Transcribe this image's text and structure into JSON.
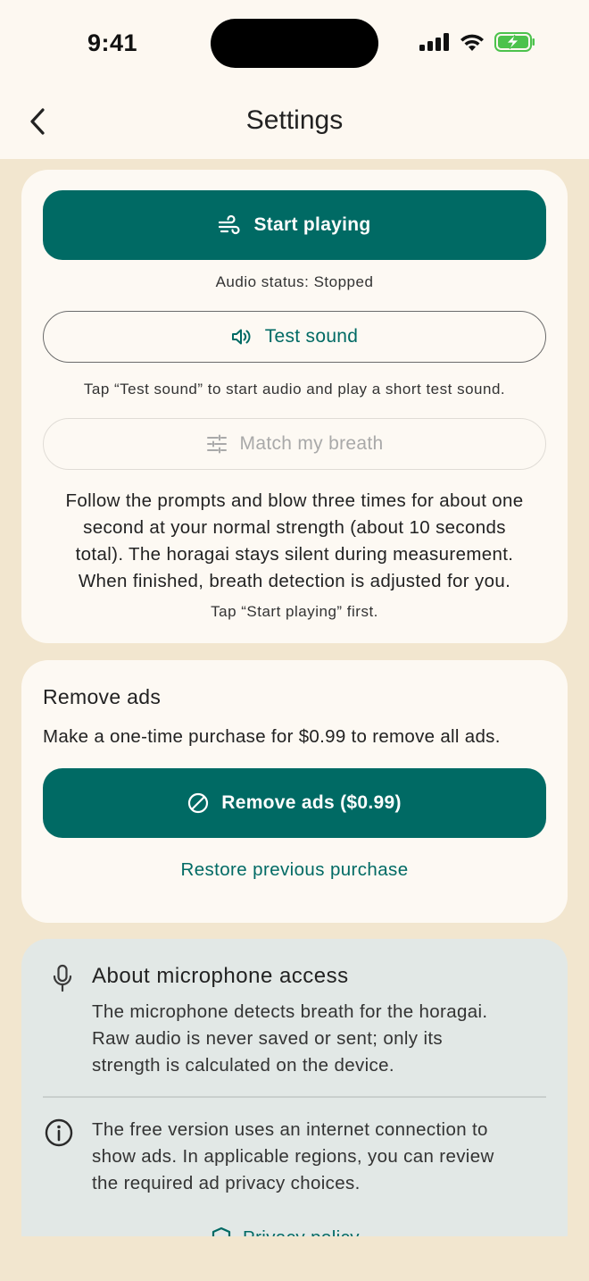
{
  "status": {
    "time": "9:41"
  },
  "nav": {
    "title": "Settings"
  },
  "audio_card": {
    "start_button": "Start playing",
    "audio_status": "Audio status: Stopped",
    "test_button": "Test sound",
    "test_hint": "Tap “Test sound” to start audio and play a short test sound.",
    "match_button": "Match my breath",
    "match_description_lines": [
      "Follow the prompts and blow three times for about one",
      "second at your normal strength (about 10 seconds",
      "total). The horagai stays silent during measurement.",
      "When finished, breath detection is adjusted for you."
    ],
    "match_hint": "Tap “Start playing” first."
  },
  "ads_card": {
    "heading": "Remove ads",
    "description": "Make a one-time purchase for $0.99 to remove all ads.",
    "remove_button": "Remove ads ($0.99)",
    "restore_link": "Restore previous purchase"
  },
  "info_card": {
    "mic_title": "About microphone access",
    "mic_body_lines": [
      "The microphone detects breath for the horagai.",
      "Raw audio is never saved or sent; only its",
      "strength is calculated on the device."
    ],
    "ads_body_lines": [
      "The free version uses an internet connection to",
      "show ads. In applicable regions, you can review",
      "the required ad privacy choices."
    ],
    "privacy_link": "Privacy policy"
  },
  "colors": {
    "accent": "#006a64",
    "background": "#f2e6cf",
    "card": "#fdf9f3",
    "info_card": "#e2e8e6"
  },
  "icons": {
    "back": "chevron-left-icon",
    "start": "wind-icon",
    "test": "speaker-icon",
    "match": "sliders-icon",
    "remove_ads": "block-icon",
    "mic": "microphone-icon",
    "info": "info-icon",
    "privacy": "shield-icon"
  }
}
